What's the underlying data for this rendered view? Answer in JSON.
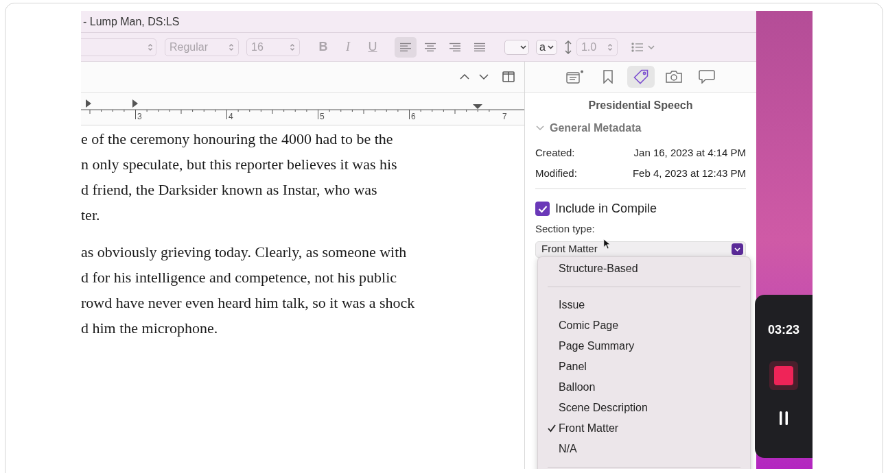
{
  "window": {
    "title": "- Lump Man, DS:LS"
  },
  "toolbar": {
    "font_style": "Regular",
    "font_size": "16",
    "style_menu": "a",
    "line_spacing": "1.0",
    "format_buttons": [
      {
        "kind": "bold",
        "label": "B"
      },
      {
        "kind": "italic",
        "label": "I"
      },
      {
        "kind": "underline",
        "label": "U"
      }
    ],
    "alignments": [
      {
        "kind": "left",
        "selected": true
      },
      {
        "kind": "center",
        "selected": false
      },
      {
        "kind": "right",
        "selected": false
      },
      {
        "kind": "justify",
        "selected": false
      }
    ]
  },
  "ruler": {
    "labels": [
      "3",
      "4",
      "5",
      "6",
      "7"
    ]
  },
  "editor": {
    "paragraphs": [
      [
        "e of the ceremony honouring the 4000 had to be the",
        "n only speculate, but this reporter believes it was his",
        "d friend, the Darksider known as Instar, who was",
        "ter."
      ],
      [
        "as obviously grieving today. Clearly, as someone with",
        "d for his intelligence and competence, not his public",
        "rowd have never even heard him talk, so it was a shock",
        "d him the microphone."
      ]
    ]
  },
  "inspector": {
    "tabs": [
      {
        "kind": "notes",
        "selected": false
      },
      {
        "kind": "bookmark",
        "selected": false
      },
      {
        "kind": "tag",
        "selected": true
      },
      {
        "kind": "camera",
        "selected": false
      },
      {
        "kind": "comment",
        "selected": false
      }
    ],
    "title": "Presidential Speech",
    "section": {
      "label": "General Metadata",
      "expanded": true
    },
    "metadata": [
      {
        "label": "Created:",
        "value": "Jan 16, 2023 at 4:14 PM"
      },
      {
        "label": "Modified:",
        "value": "Feb 4, 2023 at 12:43 PM"
      }
    ],
    "include_in_compile": {
      "label": "Include in Compile",
      "checked": true
    },
    "section_type": {
      "label": "Section type:",
      "value": "Front Matter"
    }
  },
  "menu": {
    "items": [
      {
        "kind": "item",
        "label": "Structure-Based",
        "checked": false
      },
      {
        "kind": "separator"
      },
      {
        "kind": "item",
        "label": "Issue",
        "checked": false
      },
      {
        "kind": "item",
        "label": "Comic Page",
        "checked": false
      },
      {
        "kind": "item",
        "label": "Page Summary",
        "checked": false
      },
      {
        "kind": "item",
        "label": "Panel",
        "checked": false
      },
      {
        "kind": "item",
        "label": "Balloon",
        "checked": false
      },
      {
        "kind": "item",
        "label": "Scene Description",
        "checked": false
      },
      {
        "kind": "item",
        "label": "Front Matter",
        "checked": true
      },
      {
        "kind": "item",
        "label": "N/A",
        "checked": false
      },
      {
        "kind": "separator"
      }
    ]
  },
  "recorder": {
    "time": "03:23"
  }
}
